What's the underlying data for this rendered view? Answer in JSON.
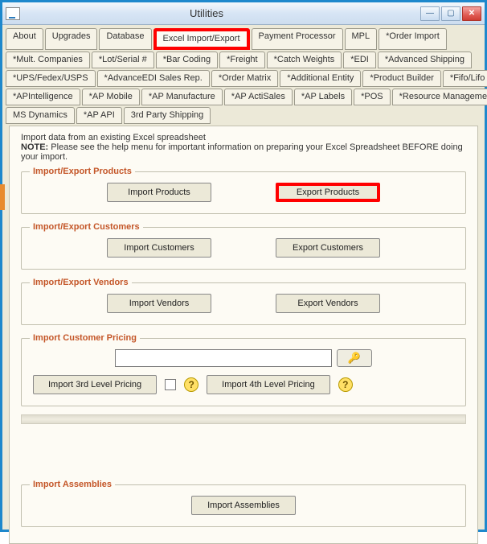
{
  "window": {
    "title": "Utilities",
    "min": "—",
    "max": "▢",
    "close": "✕"
  },
  "tabs": {
    "r0": [
      "About",
      "Upgrades",
      "Database",
      "Excel Import/Export",
      "Payment Processor",
      "MPL",
      "*Order Import"
    ],
    "r1": [
      "*Mult. Companies",
      "*Lot/Serial #",
      "*Bar Coding",
      "*Freight",
      "*Catch Weights",
      "*EDI",
      "*Advanced Shipping"
    ],
    "r2": [
      "*UPS/Fedex/USPS",
      "*AdvanceEDI Sales Rep.",
      "*Order Matrix",
      "*Additional Entity",
      "*Product Builder",
      "*Fifo/Lifo"
    ],
    "r3": [
      "*APIntelligence",
      "*AP Mobile",
      "*AP Manufacture",
      "*AP ActiSales",
      "*AP Labels",
      "*POS",
      "*Resource Management"
    ],
    "r4": [
      "MS Dynamics",
      "*AP API",
      "3rd Party Shipping"
    ]
  },
  "intro": {
    "line1": "Import data from an existing Excel spreadsheet",
    "noteLabel": "NOTE:",
    "noteText": "Please see the help menu for important information on preparing your Excel Spreadsheet BEFORE doing your import."
  },
  "groups": {
    "products": {
      "legend": "Import/Export Products",
      "importBtn": "Import Products",
      "exportBtn": "Export Products"
    },
    "customers": {
      "legend": "Import/Export Customers",
      "importBtn": "Import Customers",
      "exportBtn": "Export Customers"
    },
    "vendors": {
      "legend": "Import/Export Vendors",
      "importBtn": "Import Vendors",
      "exportBtn": "Export Vendors"
    },
    "pricing": {
      "legend": "Import Customer Pricing",
      "btn3": "Import 3rd Level Pricing",
      "btn4": "Import 4th Level Pricing",
      "keyIcon": "🔑",
      "help": "?"
    },
    "assemblies": {
      "legend": "Import Assemblies",
      "btn": "Import Assemblies"
    }
  }
}
